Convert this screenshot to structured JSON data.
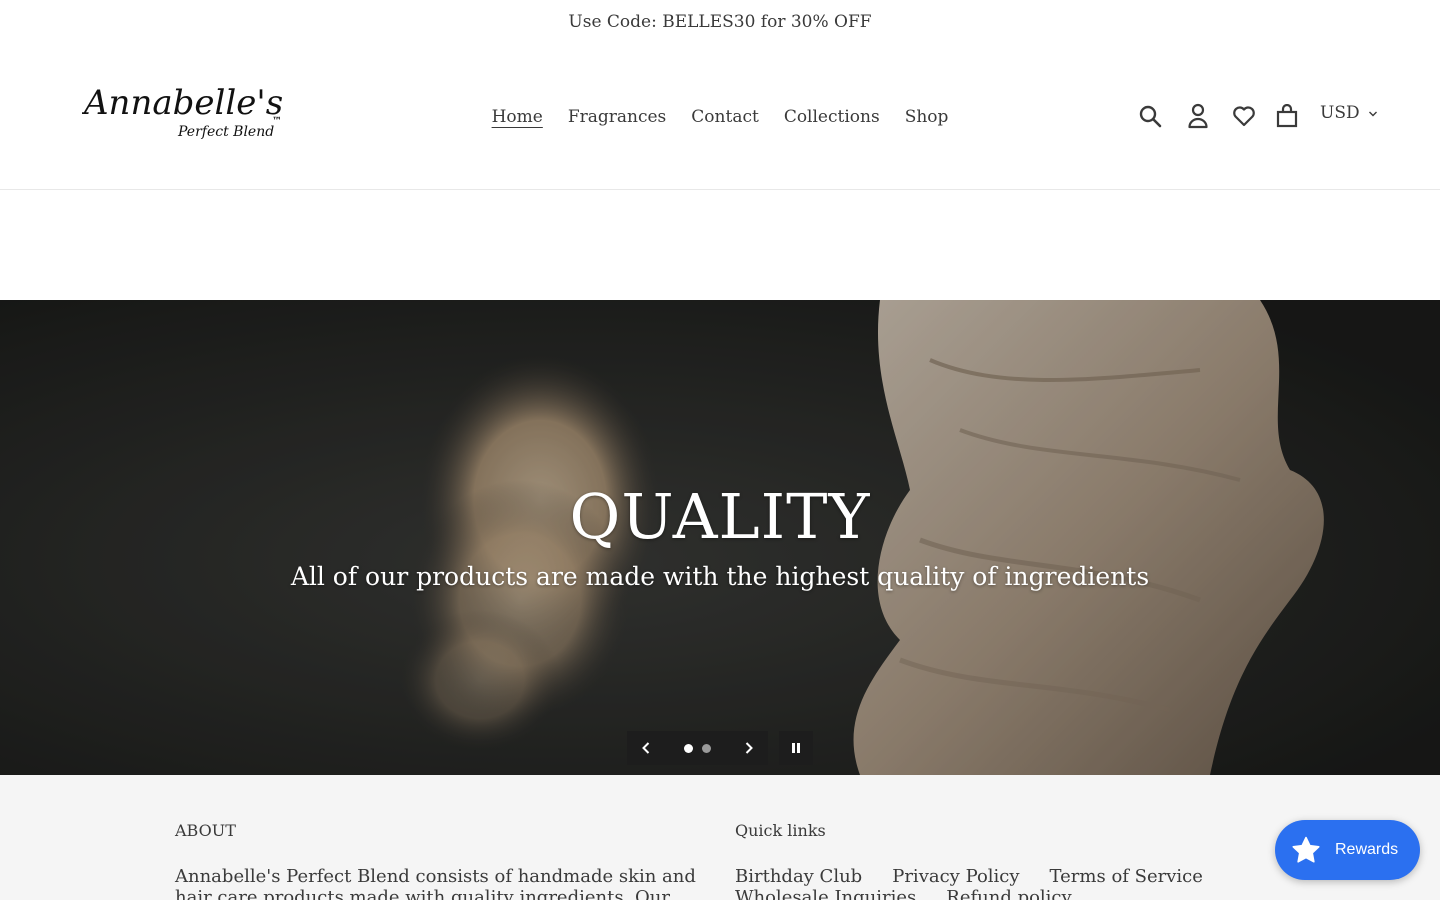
{
  "announcement": {
    "text": "Use Code: BELLES30 for 30% OFF"
  },
  "header": {
    "logo": {
      "main": "Annabelle's",
      "sub": "Perfect Blend",
      "mark": "™"
    },
    "nav": [
      {
        "label": "Home",
        "active": true
      },
      {
        "label": "Fragrances"
      },
      {
        "label": "Contact"
      },
      {
        "label": "Collections"
      },
      {
        "label": "Shop"
      }
    ],
    "icons": [
      "search-icon",
      "account-icon",
      "wishlist-heart-icon",
      "cart-icon"
    ],
    "currency": {
      "value": "USD"
    }
  },
  "hero": {
    "title": "QUALITY",
    "subtitle": "All of our products are made with the highest quality of ingredients",
    "slides_total": 2,
    "active_slide": 1
  },
  "footer": {
    "about_heading": "ABOUT",
    "about_text": "Annabelle's Perfect Blend consists of handmade skin and hair care products made with quality ingredients. Our products will",
    "quick_links_heading": "Quick links",
    "quick_links": [
      "Birthday Club",
      "Privacy Policy",
      "Terms of Service",
      "Wholesale Inquiries",
      "Refund policy"
    ]
  },
  "rewards": {
    "label": "Rewards"
  },
  "colors": {
    "accent": "#2b70f0",
    "text": "#3a3a3a",
    "footer_bg": "#f5f5f5",
    "hero_bg": "#262626"
  }
}
